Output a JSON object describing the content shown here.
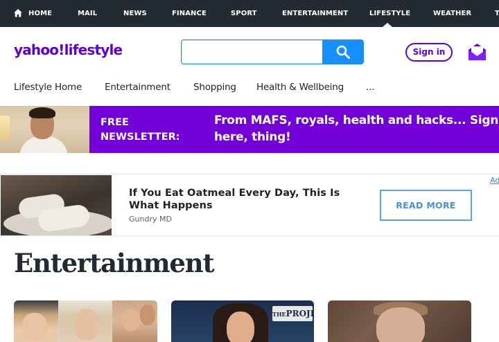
{
  "top_nav": {
    "items": [
      "HOME",
      "MAIL",
      "NEWS",
      "FINANCE",
      "SPORT",
      "ENTERTAINMENT",
      "LIFESTYLE",
      "WEATHER",
      "T"
    ],
    "active": "LIFESTYLE"
  },
  "header": {
    "logo_brand": "yahoo!",
    "logo_section": "lifestyle",
    "search_placeholder": "",
    "sign_in_label": "Sign in"
  },
  "sub_nav": {
    "items": [
      "Lifestyle Home",
      "Entertainment",
      "Shopping",
      "Health & Wellbeing",
      "..."
    ]
  },
  "newsletter": {
    "label_line1": "FREE",
    "label_line2": "NEWSLETTER:",
    "pitch": "From MAFS, royals, health and hacks... Sign up here, thing!"
  },
  "ad": {
    "headline": "If You Eat Oatmeal Every Day, This Is What Happens",
    "sponsor": "Gundry MD",
    "cta_label": "READ MORE",
    "ad_choice_label": "Ad"
  },
  "section": {
    "title": "Entertainment"
  },
  "cards": [
    {
      "tag": ""
    },
    {
      "tag": "PROJECT"
    },
    {
      "tag": ""
    }
  ],
  "colors": {
    "top_nav_bg": "#232a31",
    "brand_purple": "#6001d2",
    "search_blue": "#188fff",
    "newsletter_bg": "#7300d8",
    "cta_border": "#5aa2e6"
  },
  "icons": {
    "home": "home-icon",
    "search": "search-icon",
    "mail": "mail-icon"
  }
}
